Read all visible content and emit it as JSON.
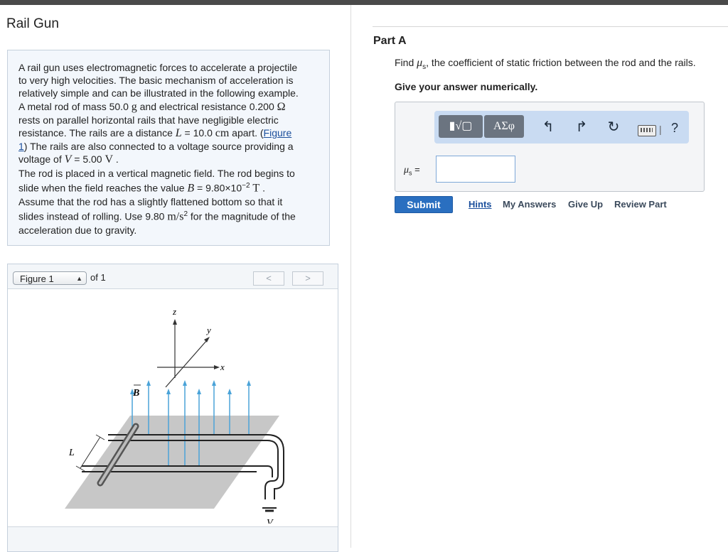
{
  "page": {
    "title": "Rail Gun"
  },
  "problem": {
    "line1": "A rail gun uses electromagnetic forces to accelerate a projectile",
    "line2": "to very high velocities. The basic mechanism of acceleration is",
    "line3": "relatively simple and can be illustrated in the following example.",
    "line4a": "A metal rod of mass 50.0 ",
    "mass_unit": "g",
    "line4b": " and electrical resistance 0.200 ",
    "ohm": "Ω",
    "line5": "rests on parallel horizontal rails that have negligible electric",
    "line6a": "resistance. The rails are a distance ",
    "L_sym": "L",
    "line6b": " = 10.0 ",
    "cm_unit": "cm",
    "line6c": " apart. (",
    "figure_link_a": "Figure",
    "figure_link_b": "1",
    "line7": ") The rails are also connected to a voltage source providing a",
    "line8a": "voltage of ",
    "V_sym": "V",
    "line8b": " = 5.00 ",
    "V_unit": "V",
    "line8c": " .",
    "line9": "The rod is placed in a vertical magnetic field. The rod begins to",
    "line10a": "slide when the field reaches the value ",
    "B_sym": "B",
    "line10b": " = 9.80×10",
    "exp": "−2",
    "T_unit": "T",
    "line10c": " .",
    "line11": "Assume that the rod has a slightly flattened bottom so that it",
    "line12a": "slides instead of rolling. Use 9.80 ",
    "g_unit": "m/s",
    "sq": "2",
    "line12b": " for the magnitude of the",
    "line13": "acceleration due to gravity."
  },
  "figure": {
    "selected": "Figure 1",
    "of_text": "of 1",
    "prev": "<",
    "next": ">",
    "labels": {
      "z": "z",
      "y": "y",
      "x": "x",
      "B": "B",
      "L": "L",
      "V": "V"
    }
  },
  "part": {
    "title": "Part A",
    "find_pre": "Find ",
    "mu": "μ",
    "mu_sub": "s",
    "find_post": ", the coefficient of static friction between the rod and the rails.",
    "instruction": "Give your answer numerically.",
    "answer_value": "",
    "submit": "Submit",
    "hints": "Hints",
    "my_answers": "My Answers",
    "give_up": "Give Up",
    "review": "Review Part"
  },
  "toolbar": {
    "templates_btn": "▮√▢",
    "symbols_btn": "ΑΣφ",
    "undo": "↰",
    "redo": "↱",
    "reset": "↻",
    "sep": "|",
    "help": "?"
  },
  "answer_label": {
    "eq": " ="
  }
}
